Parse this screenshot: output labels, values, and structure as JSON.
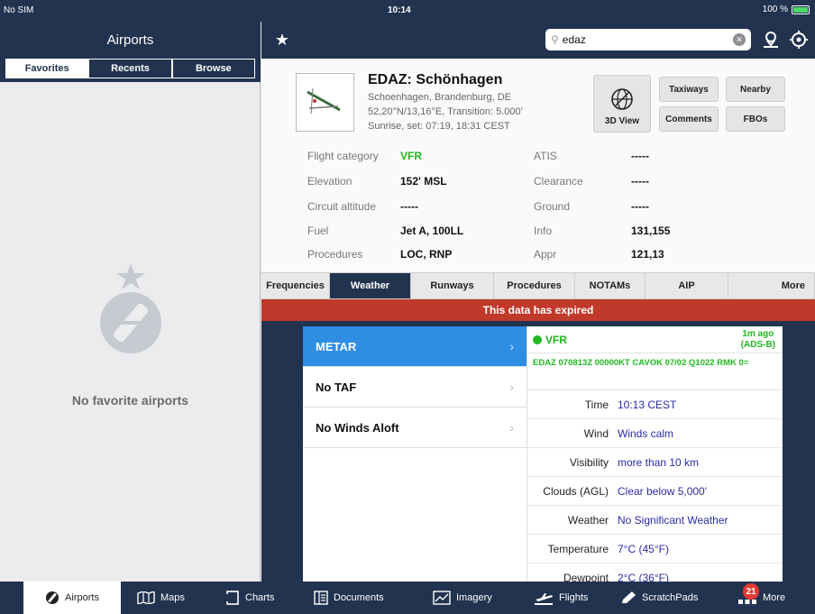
{
  "status_bar": {
    "carrier": "No SIM",
    "time": "10:14",
    "battery": "100 %"
  },
  "left_panel": {
    "title": "Airports",
    "segments": [
      "Favorites",
      "Recents",
      "Browse"
    ],
    "active_segment": "Favorites",
    "empty_text": "No favorite airports"
  },
  "search": {
    "value": "edaz",
    "placeholder": ""
  },
  "airport": {
    "title": "EDAZ: Schönhagen",
    "line1": "Schoenhagen, Brandenburg, DE",
    "line2": "52,20°N/13,16°E, Transition: 5.000'",
    "line3": "Sunrise, set: 07:19, 18:31 CEST",
    "actions": {
      "view3d": "3D View",
      "taxiways": "Taxiways",
      "nearby": "Nearby",
      "comments": "Comments",
      "fbos": "FBOs"
    },
    "left_fields": [
      {
        "label": "Flight category",
        "value": "VFR"
      },
      {
        "label": "Elevation",
        "value": "152' MSL"
      },
      {
        "label": "Circuit altitude",
        "value": "-----"
      },
      {
        "label": "Fuel",
        "value": "Jet A, 100LL"
      },
      {
        "label": "Procedures",
        "value": "LOC, RNP"
      }
    ],
    "right_fields": [
      {
        "label": "ATIS",
        "value": "-----"
      },
      {
        "label": "Clearance",
        "value": "-----"
      },
      {
        "label": "Ground",
        "value": "-----"
      },
      {
        "label": "Info",
        "value": "131,155"
      },
      {
        "label": "Appr",
        "value": "121,13"
      }
    ]
  },
  "tabs": [
    "Frequencies",
    "Weather",
    "Runways",
    "Procedures",
    "NOTAMs",
    "AIP",
    "More"
  ],
  "active_tab": "Weather",
  "banner": "This data has expired",
  "weather": {
    "list": [
      {
        "label": "METAR",
        "active": true
      },
      {
        "label": "No TAF",
        "active": false
      },
      {
        "label": "No Winds Aloft",
        "active": false
      }
    ],
    "category": "VFR",
    "age_line1": "1m ago",
    "age_line2": "(ADS-B)",
    "raw": "EDAZ 070813Z 00000KT CAVOK 07/02 Q1022 RMK 0=",
    "rows": [
      {
        "label": "Time",
        "value": "10:13 CEST"
      },
      {
        "label": "Wind",
        "value": "Winds calm"
      },
      {
        "label": "Visibility",
        "value": "more than 10 km"
      },
      {
        "label": "Clouds (AGL)",
        "value": "Clear below 5,000'"
      },
      {
        "label": "Weather",
        "value": "No Significant Weather"
      },
      {
        "label": "Temperature",
        "value": "7°C (45°F)"
      },
      {
        "label": "Dewpoint",
        "value": "2°C (36°F)"
      }
    ]
  },
  "bottom_tabs": {
    "airports": "Airports",
    "maps": "Maps",
    "charts": "Charts",
    "documents": "Documents",
    "imagery": "Imagery",
    "flights": "Flights",
    "scratchpads": "ScratchPads",
    "more": "More",
    "more_badge": "21"
  },
  "colors": {
    "navy": "#22334f",
    "accent_blue": "#2f8de4",
    "vfr_green": "#1fb91f",
    "expired_red": "#c0392b",
    "value_blue": "#2b2ba8"
  }
}
